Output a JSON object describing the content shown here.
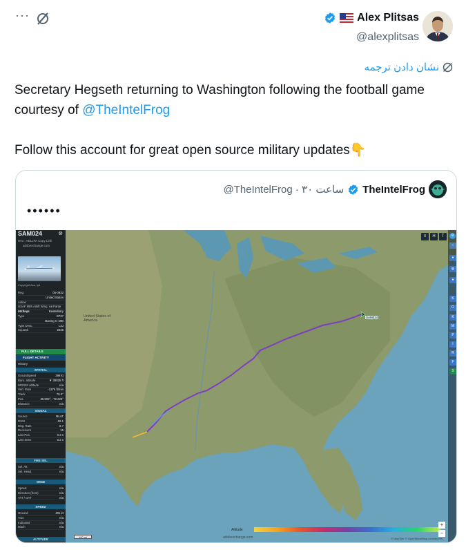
{
  "header": {
    "more_label": "···",
    "user_name": "Alex Plitsas",
    "user_handle": "@alexplitsas",
    "icons": {
      "more": "more-dots-icon",
      "grok": "grok-slash-icon",
      "flag": "us-flag-icon",
      "verified": "verified-badge-icon",
      "avatar": "user-avatar"
    }
  },
  "translate": {
    "label": "نشان دادن ترجمه",
    "icon": "translate-globe-icon"
  },
  "tweet": {
    "line1": "Secretary Hegseth returning to Washington following the football game",
    "line2_prefix": "courtesy of ",
    "line2_mention": "@TheIntelFrog",
    "line3": "Follow this account for great open source military updates",
    "line3_emoji": "👇"
  },
  "quote": {
    "name": "TheIntelFrog",
    "handle_time": "@TheIntelFrog · ۳۰ ساعت",
    "text": "••••••"
  },
  "flight_panel": {
    "callsign": "SAM024",
    "hex_line": "Hex : AE1LPA  Copy Link",
    "site": "adsbexchange.com",
    "photo_caption": "Copyright Asa, lyd",
    "rows": [
      [
        "Reg.",
        "05-0932"
      ],
      [
        "",
        "United States"
      ],
      [
        "Airline",
        ""
      ],
      [
        "USAF 89th Airlift Wing Andrews",
        "Air Force Base"
      ],
      [
        "DB flags",
        "military"
      ],
      [
        "Type",
        "B737"
      ],
      [
        "",
        "Boeing C-40B"
      ],
      [
        "Type Desc.",
        "L2J"
      ],
      [
        "Squawk",
        "2046"
      ]
    ],
    "full_details": "FULL DETAILS",
    "flight_activity": "FLIGHT ACTIVITY",
    "history": "History",
    "spatial": "SPATIAL",
    "spatial_rows": [
      [
        "Groundspeed",
        "298 kt"
      ],
      [
        "Baro. altitude",
        "▼ 39025 ft"
      ],
      [
        "WGS84 altitude",
        "n/a"
      ],
      [
        "Vert. Rate",
        "-1376 ft/min"
      ],
      [
        "Track",
        "76.0°"
      ],
      [
        "Pos.",
        "35.902°, -79.229°"
      ],
      [
        "Distance",
        "n/a"
      ]
    ],
    "signal": "SIGNAL",
    "signal_rows": [
      [
        "Source",
        "MLAT"
      ],
      [
        "RSSI",
        "-19.1"
      ],
      [
        "Msg. Rate",
        "6.7"
      ],
      [
        "Receivers",
        "16"
      ],
      [
        "Last Pos.",
        "0.3 s"
      ],
      [
        "Last Seen",
        "0.2 s"
      ]
    ],
    "fms_sel": "FMS SEL",
    "fms_rows": [
      [
        "Sel. Alt.",
        "n/a"
      ],
      [
        "Sel. Head.",
        "n/a"
      ]
    ],
    "wind": "WIND",
    "wind_rows": [
      [
        "Speed",
        "n/a"
      ],
      [
        "Direction (from)",
        "n/a"
      ],
      [
        "TAT / OAT",
        "n/a"
      ]
    ],
    "speed": "SPEED",
    "speed_rows": [
      [
        "Ground",
        "401 kt"
      ],
      [
        "True",
        "n/a"
      ],
      [
        "Indicated",
        "n/a"
      ],
      [
        "Mach",
        "n/a"
      ]
    ],
    "altitude": "ALTITUDE"
  },
  "map": {
    "label_us": "United States of America",
    "label_aircraft": "SAM024",
    "top_buttons": [
      "≡",
      "H",
      "T"
    ],
    "legend_label": "Altitude",
    "watermark": "adsbexchange.com",
    "attrib": "© MapTiler © OpenStreetMap contributors",
    "scale": "100 mi",
    "zoom_in": "+",
    "zoom_out": "−",
    "toolbar_buttons": [
      "K",
      "O",
      "K",
      "M",
      "P",
      "I",
      "R",
      "F",
      "S"
    ],
    "colors": {
      "track_purple": "#7d3fbf",
      "track_start": "#e4c12f",
      "land": "#8c9a6c",
      "water": "#6aa3bb"
    }
  }
}
